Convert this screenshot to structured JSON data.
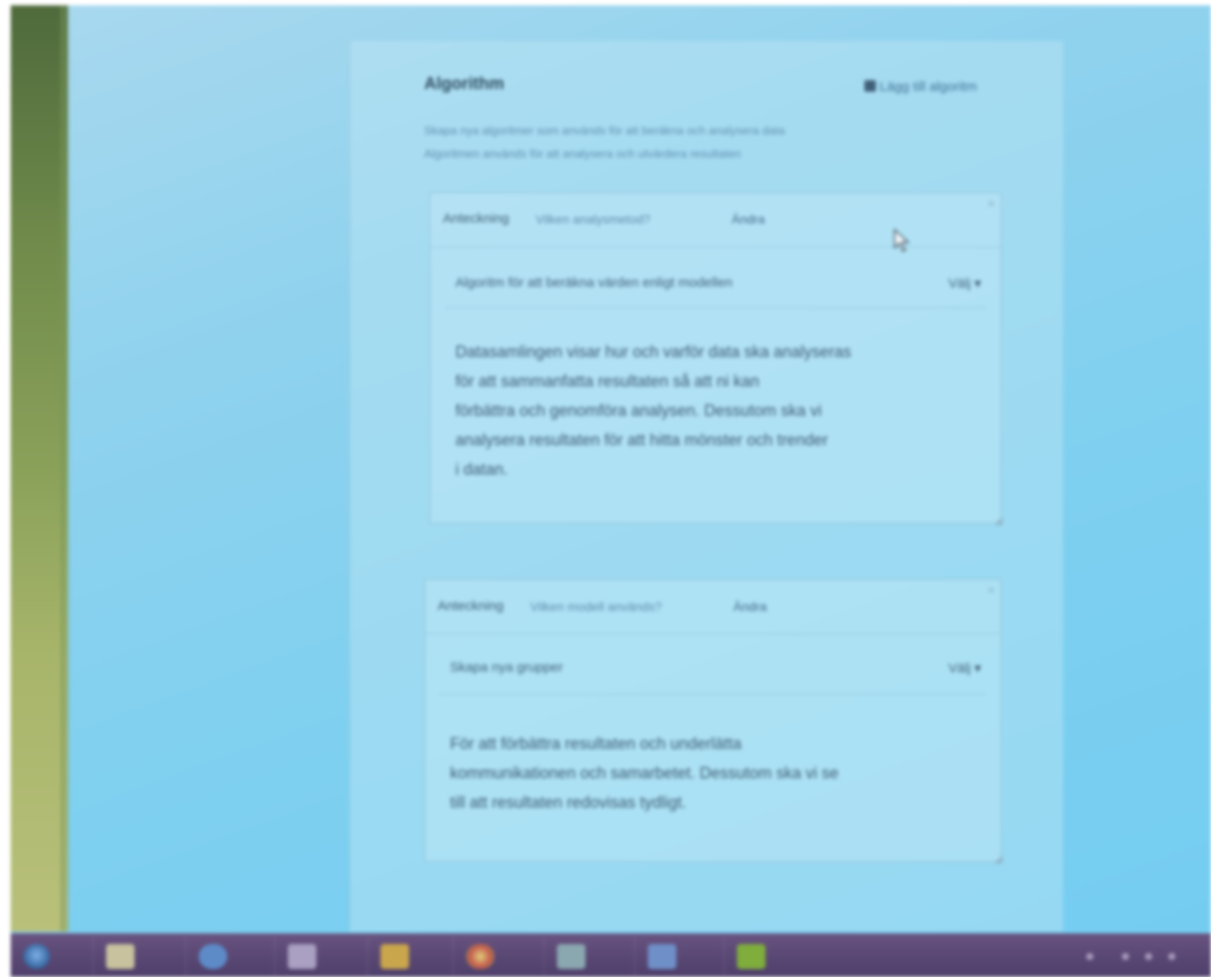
{
  "section": {
    "title": "Algorithm",
    "action_label": "Lägg till algoritm",
    "description_lines": [
      "Skapa nya algoritmer som används för att beräkna och analysera data",
      "Algoritmen används för att analysera och utvärdera resultaten"
    ]
  },
  "cards": [
    {
      "label": "Anteckning",
      "meta": "Vilken analysmetod?",
      "meta_action": "Ändra",
      "row_title": "Algoritm för att beräkna värden enligt modellen",
      "row_select": "Välj ▾",
      "body_lines": [
        "Datasamlingen visar hur och varför data ska analyseras",
        "för att sammanfatta resultaten så att ni kan",
        "förbättra och genomföra analysen. Dessutom ska vi",
        "analysera resultaten för att hitta mönster och trender",
        "i datan."
      ]
    },
    {
      "label": "Anteckning",
      "meta": "Vilken modell används?",
      "meta_action": "Ändra",
      "row_title": "Skapa nya grupper",
      "row_select": "Välj ▾",
      "body_lines": [
        "För att förbättra resultaten och underlätta",
        "kommunikationen och samarbetet. Dessutom ska vi se",
        "till att resultaten redovisas tydligt."
      ]
    }
  ],
  "taskbar": {
    "apps": [
      "start-icon",
      "file-explorer-icon",
      "internet-explorer-icon",
      "media-player-icon",
      "paint-icon",
      "chrome-icon",
      "outlook-icon",
      "word-icon",
      "notes-icon"
    ]
  },
  "colors": {
    "screen_bg": "#7fd0f0",
    "taskbar_bg": "#5d4a77",
    "left_strip": "#8aa15a",
    "text_dark": "#3d5a72",
    "link": "#3f6f93"
  }
}
